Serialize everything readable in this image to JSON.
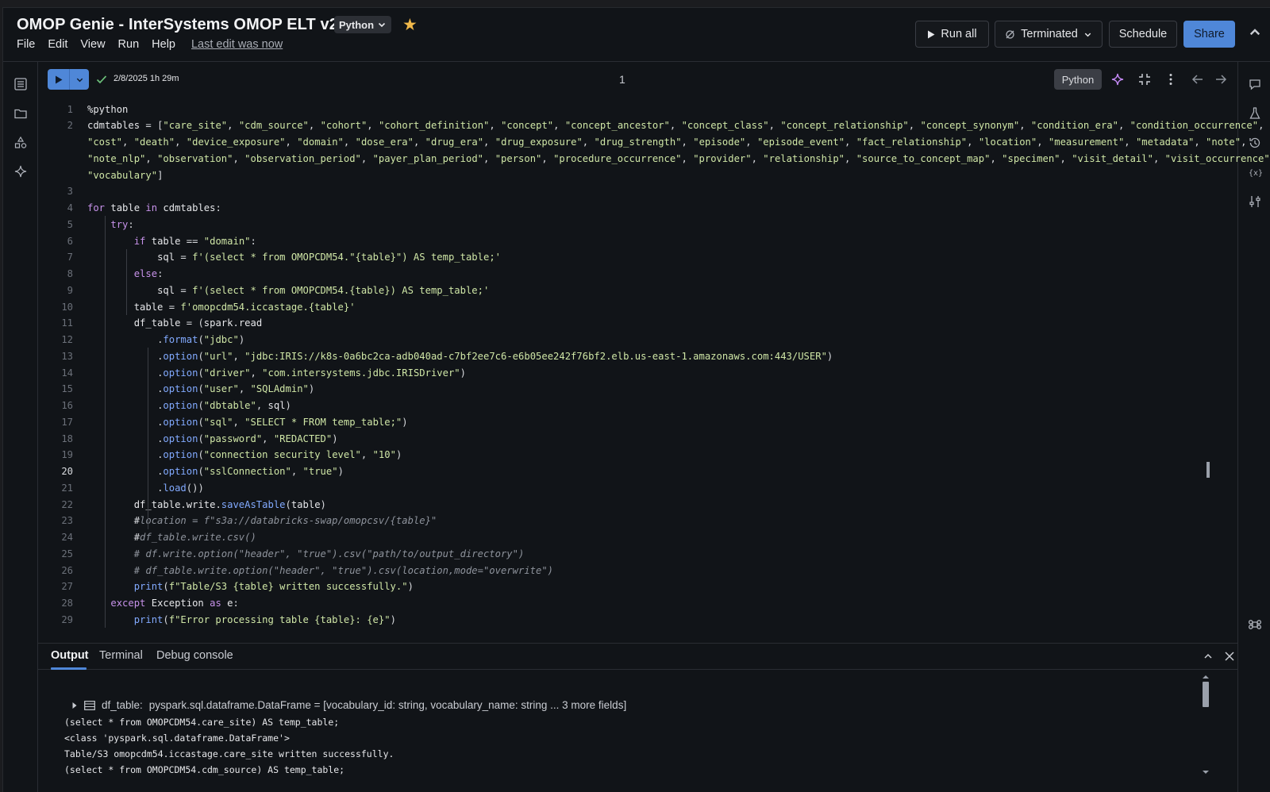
{
  "app": {
    "title": "OMOP Genie - InterSystems OMOP ELT v2",
    "language": "Python",
    "last_edit": "Last edit was now"
  },
  "menu": [
    "File",
    "Edit",
    "View",
    "Run",
    "Help"
  ],
  "header_buttons": {
    "run_all": "Run all",
    "cluster": "Terminated",
    "schedule": "Schedule",
    "share": "Share"
  },
  "cell": {
    "runtime": "2/8/2025 1h 29m",
    "number": "1",
    "language": "Python"
  },
  "code_lines": [
    {
      "n": "1",
      "t": "%python"
    },
    {
      "n": "2",
      "t": "cdmtables = [\"care_site\", \"cdm_source\", \"cohort\", \"cohort_definition\", \"concept\", \"concept_ancestor\", \"concept_class\", \"concept_relationship\", \"concept_synonym\", \"condition_era\", \"condition_occurrence\","
    },
    {
      "n": "",
      "t": "\"cost\", \"death\", \"device_exposure\", \"domain\", \"dose_era\", \"drug_era\", \"drug_exposure\", \"drug_strength\", \"episode\", \"episode_event\", \"fact_relationship\", \"location\", \"measurement\", \"metadata\", \"note\","
    },
    {
      "n": "",
      "t": "\"note_nlp\", \"observation\", \"observation_period\", \"payer_plan_period\", \"person\", \"procedure_occurrence\", \"provider\", \"relationship\", \"source_to_concept_map\", \"specimen\", \"visit_detail\", \"visit_occurrence\","
    },
    {
      "n": "",
      "t": "\"vocabulary\"]"
    },
    {
      "n": "3",
      "t": ""
    },
    {
      "n": "4",
      "t": "for table in cdmtables:"
    },
    {
      "n": "5",
      "t": "    try:"
    },
    {
      "n": "6",
      "t": "        if table == \"domain\":"
    },
    {
      "n": "7",
      "t": "            sql = f'(select * from OMOPCDM54.\"{table}\") AS temp_table;'"
    },
    {
      "n": "8",
      "t": "        else:"
    },
    {
      "n": "9",
      "t": "            sql = f'(select * from OMOPCDM54.{table}) AS temp_table;'"
    },
    {
      "n": "10",
      "t": "        table = f'omopcdm54.iccastage.{table}'"
    },
    {
      "n": "11",
      "t": "        df_table = (spark.read"
    },
    {
      "n": "12",
      "t": "            .format(\"jdbc\")"
    },
    {
      "n": "13",
      "t": "            .option(\"url\", \"jdbc:IRIS://k8s-0a6bc2ca-adb040ad-c7bf2ee7c6-e6b05ee242f76bf2.elb.us-east-1.amazonaws.com:443/USER\")"
    },
    {
      "n": "14",
      "t": "            .option(\"driver\", \"com.intersystems.jdbc.IRISDriver\")"
    },
    {
      "n": "15",
      "t": "            .option(\"user\", \"SQLAdmin\")"
    },
    {
      "n": "16",
      "t": "            .option(\"dbtable\", sql)"
    },
    {
      "n": "17",
      "t": "            .option(\"sql\", \"SELECT * FROM temp_table;\")"
    },
    {
      "n": "18",
      "t": "            .option(\"password\", \"REDACTED\")"
    },
    {
      "n": "19",
      "t": "            .option(\"connection security level\", \"10\")"
    },
    {
      "n": "20",
      "t": "            .option(\"sslConnection\", \"true\")"
    },
    {
      "n": "21",
      "t": "            .load())"
    },
    {
      "n": "22",
      "t": "        df_table.write.saveAsTable(table)"
    },
    {
      "n": "23",
      "t": "        #location = f\"s3a://databricks-swap/omopcsv/{table}\""
    },
    {
      "n": "24",
      "t": "        #df_table.write.csv()"
    },
    {
      "n": "25",
      "t": "        # df.write.option(\"header\", \"true\").csv(\"path/to/output_directory\")"
    },
    {
      "n": "26",
      "t": "        # df_table.write.option(\"header\", \"true\").csv(location,mode=\"overwrite\")"
    },
    {
      "n": "27",
      "t": "        print(f\"Table/S3 {table} written successfully.\")"
    },
    {
      "n": "28",
      "t": "    except Exception as e:"
    },
    {
      "n": "29",
      "t": "        print(f\"Error processing table {table}: {e}\")"
    }
  ],
  "current_line": "20",
  "panel": {
    "tabs": [
      "Output",
      "Terminal",
      "Debug console"
    ],
    "df_name": "df_table:",
    "df_type": "pyspark.sql.dataframe.DataFrame = [vocabulary_id: string, vocabulary_name: string ... 3 more fields]",
    "output_lines": [
      "(select * from OMOPCDM54.care_site) AS temp_table;",
      "<class 'pyspark.sql.dataframe.DataFrame'>",
      "Table/S3 omopcdm54.iccastage.care_site written successfully.",
      "(select * from OMOPCDM54.cdm_source) AS temp_table;"
    ]
  },
  "icons": {
    "left_rail": [
      "table-of-contents-icon",
      "folder-icon",
      "shapes-icon",
      "sparkle-icon"
    ],
    "right_rail": [
      "comment-icon",
      "experiment-icon",
      "history-icon",
      "variables-icon",
      "settings-sliders-icon",
      "command-icon"
    ]
  },
  "colors": {
    "accent": "#4f87d8",
    "star": "#f0b84a",
    "success": "#6cc07a"
  }
}
